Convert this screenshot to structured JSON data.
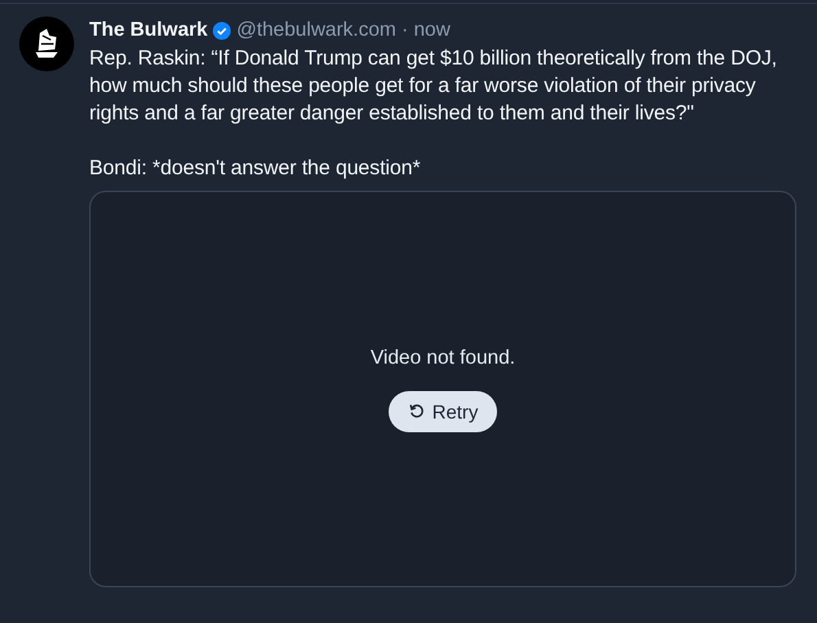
{
  "post": {
    "author": "The Bulwark",
    "verified": true,
    "handle": "@thebulwark.com",
    "separator": "·",
    "time": "now",
    "paragraphs": [
      "Rep. Raskin: “If Donald Trump can get $10 billion theoretically from the DOJ, how much should these people get for a far worse violation of their privacy rights and a far greater danger established to them and their lives?\"",
      "Bondi: *doesn't answer the question*"
    ],
    "video": {
      "message": "Video not found.",
      "retry_label": "Retry"
    }
  }
}
